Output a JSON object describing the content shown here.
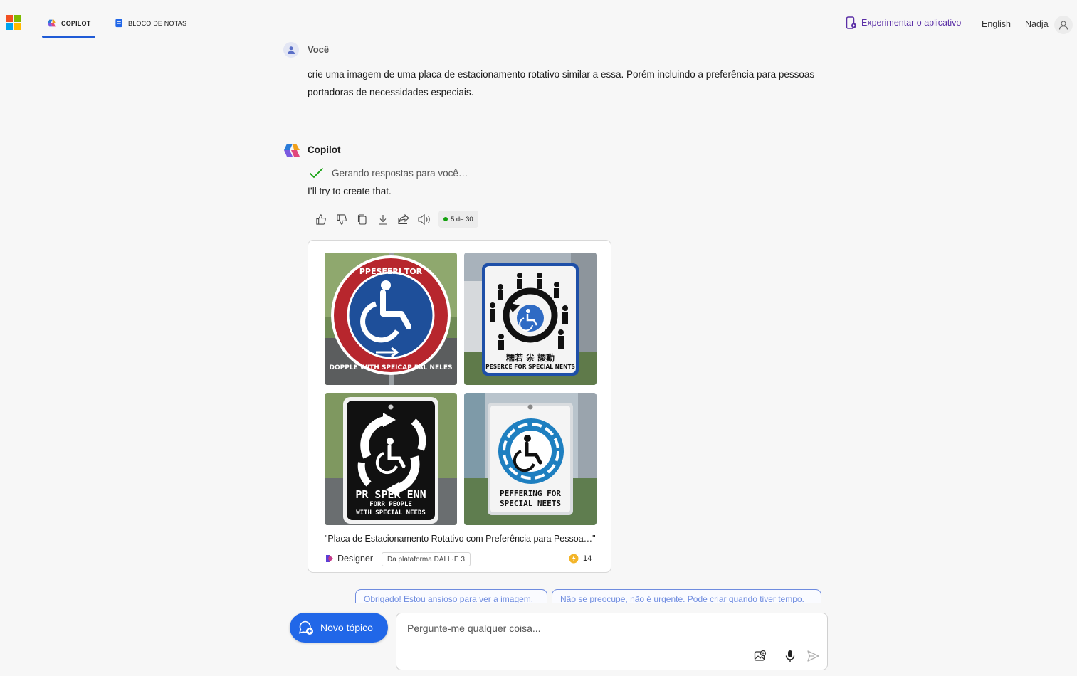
{
  "header": {
    "tabs": [
      {
        "label": "COPILOT",
        "icon": "copilot-icon",
        "active": true
      },
      {
        "label": "BLOCO DE NOTAS",
        "icon": "notebook-icon",
        "active": false
      }
    ],
    "try_app": "Experimentar o aplicativo",
    "language": "English",
    "user_name": "Nadja",
    "colors": {
      "accent": "#1f5bd6",
      "try_app": "#5a2ea6"
    }
  },
  "conversation": {
    "user": {
      "label": "Você",
      "message": "crie uma imagem de uma placa de estacionamento rotativo similar a essa. Porém incluindo a preferência para pessoas  portadoras de necessidades especiais."
    },
    "copilot": {
      "label": "Copilot",
      "status": "Gerando respostas para você…",
      "reply": "I’ll try to create that.",
      "actions": [
        "thumbs-up-icon",
        "thumbs-down-icon",
        "copy-icon",
        "download-icon",
        "share-icon",
        "speaker-icon"
      ],
      "counter": "5 de 30"
    },
    "image_card": {
      "caption": "\"Placa de Estacionamento Rotativo com Preferência para Pessoa…\"",
      "designer_label": "Designer",
      "platform_badge": "Da plataforma DALL·E 3",
      "boost_count": "14",
      "images": [
        {
          "sign_text_top": "PPESFERI TOR",
          "sign_text_bottom": "DOPPLE WITH SPEICAP PAL NELES"
        },
        {
          "sign_text_cjk": "糯若 尜 謖勳",
          "sign_text_bottom": "PESERCE FOR SPECIAL NENTS"
        },
        {
          "sign_line1": "PR SPER ENN",
          "sign_line2": "FORR   PEOPLE",
          "sign_line3": "WITH SPECIAL NEEDS"
        },
        {
          "sign_line1": "PEFFERING FOR",
          "sign_line2": "SPECIAL NEETS"
        }
      ]
    }
  },
  "suggestions": [
    "Obrigado! Estou ansioso para ver a imagem.",
    "Não se preocupe, não é urgente. Pode criar quando tiver tempo."
  ],
  "composer": {
    "new_topic": "Novo tópico",
    "placeholder": "Pergunte-me qualquer coisa..."
  }
}
